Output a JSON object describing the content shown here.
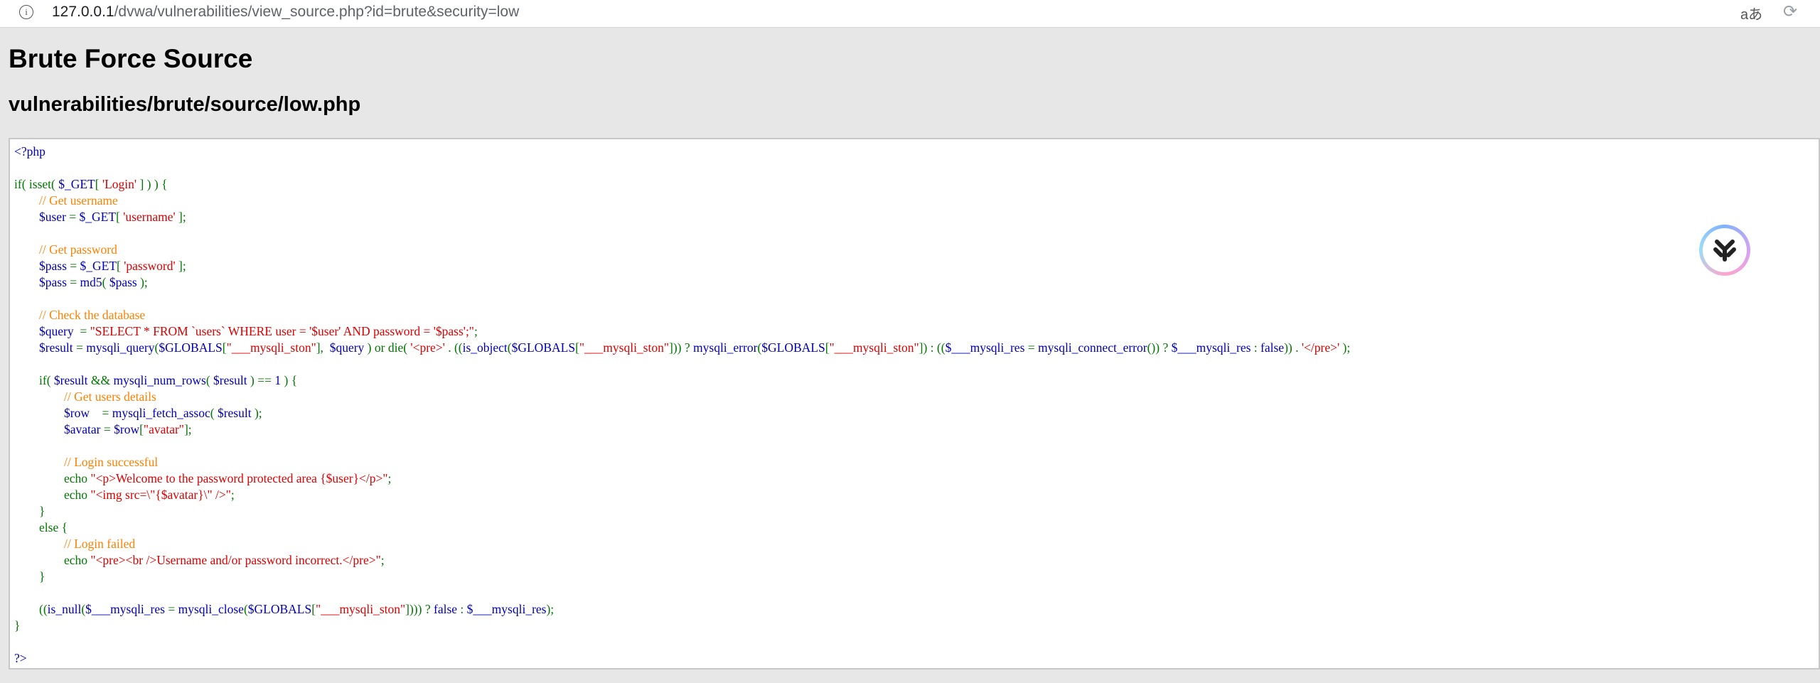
{
  "browser": {
    "url_host": "127.0.0.1",
    "url_path": "/dvwa/vulnerabilities/view_source.php?id=brute&security=low",
    "info_icon": "info-icon",
    "translate_label": "aあ",
    "reload_icon": "reload-icon"
  },
  "page": {
    "title": "Brute Force Source",
    "file_path": "vulnerabilities/brute/source/low.php"
  },
  "source_code": {
    "language": "php",
    "lines": [
      "<?php",
      "",
      "if( isset( $_GET[ 'Login' ] ) ) {",
      "\t// Get username",
      "\t$user = $_GET[ 'username' ];",
      "",
      "\t// Get password",
      "\t$pass = $_GET[ 'password' ];",
      "\t$pass = md5( $pass );",
      "",
      "\t// Check the database",
      "\t$query  = \"SELECT * FROM `users` WHERE user = '$user' AND password = '$pass';\";",
      "\t$result = mysqli_query($GLOBALS[\"___mysqli_ston\"],  $query ) or die( '<pre>' . ((is_object($GLOBALS[\"___mysqli_ston\"])) ? mysqli_error($GLOBALS[\"___mysqli_ston\"]) : (($___mysqli_res = mysqli_connect_error()) ? $___mysqli_res : false)) . '</pre>' );",
      "",
      "\tif( $result && mysqli_num_rows( $result ) == 1 ) {",
      "\t\t// Get users details",
      "\t\t$row    = mysqli_fetch_assoc( $result );",
      "\t\t$avatar = $row[\"avatar\"];",
      "",
      "\t\t// Login successful",
      "\t\techo \"<p>Welcome to the password protected area {$user}</p>\";",
      "\t\techo \"<img src=\\\"{$avatar}\\\" />\";",
      "\t}",
      "\telse {",
      "\t\t// Login failed",
      "\t\techo \"<pre><br />Username and/or password incorrect.</pre>\";",
      "\t}",
      "",
      "\t((is_null($___mysqli_res = mysqli_close($GLOBALS[\"___mysqli_ston\"]))) ? false : $___mysqli_res);",
      "}",
      "",
      "?>"
    ]
  },
  "floating_badge": {
    "icon": "extension-logo-icon"
  },
  "colors": {
    "php_default": "#0000bb",
    "php_keyword": "#007700",
    "php_comment": "#ff8000",
    "php_string": "#dd0000",
    "page_background": "#e7e7e7"
  }
}
